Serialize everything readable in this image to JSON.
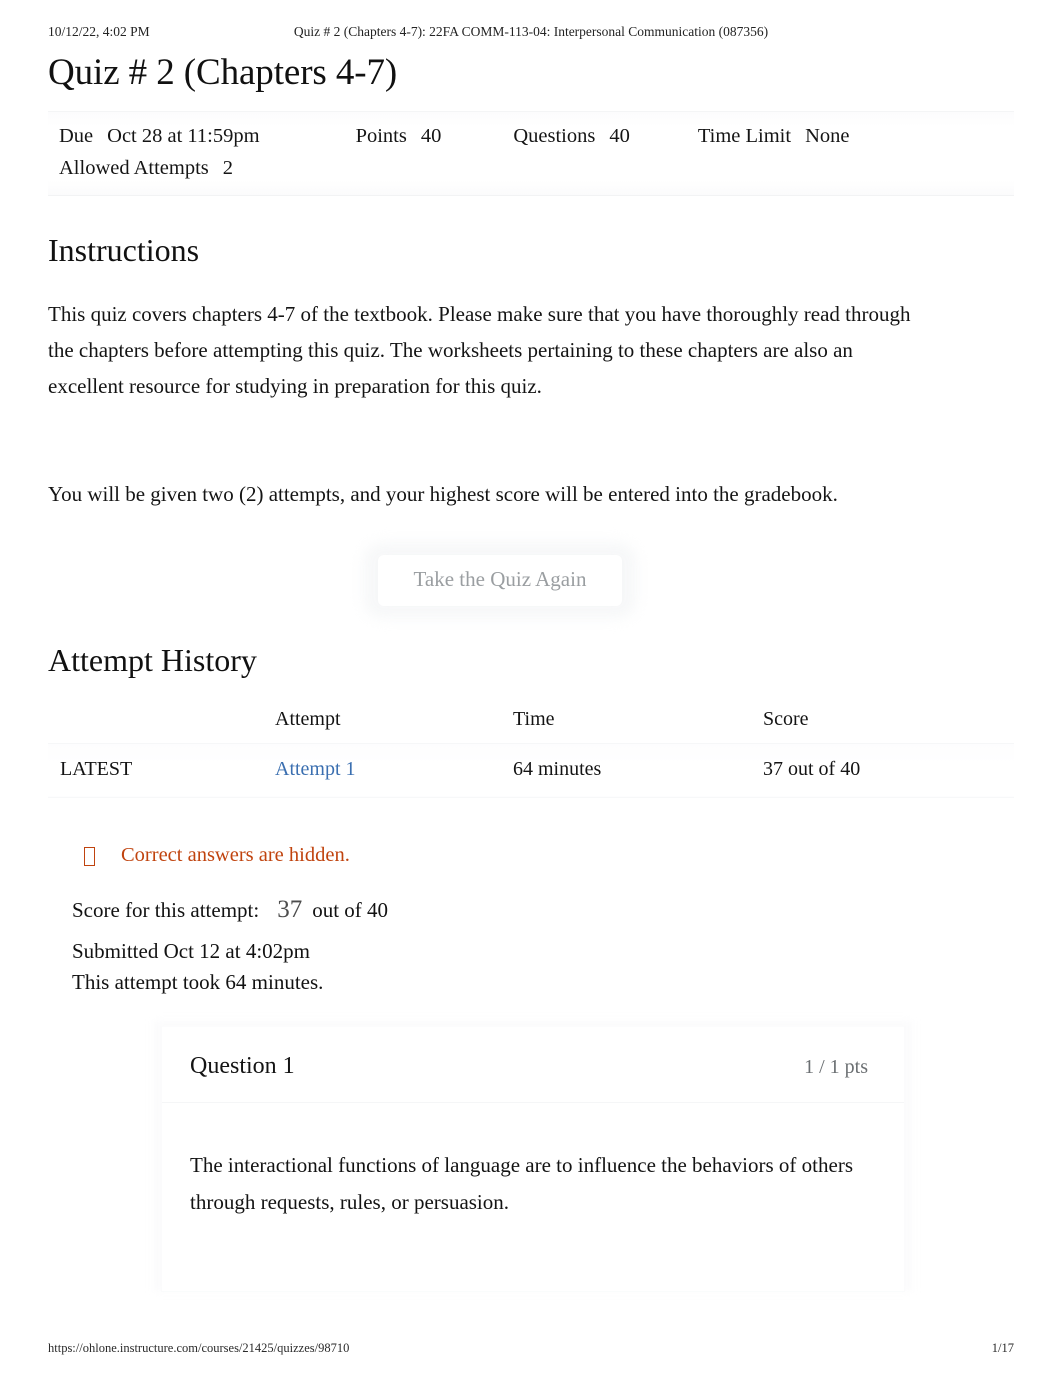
{
  "print_header": {
    "date": "10/12/22, 4:02 PM",
    "document_title": "Quiz # 2 (Chapters 4-7): 22FA COMM-113-04: Interpersonal Communication (087356)"
  },
  "print_footer": {
    "url": "https://ohlone.instructure.com/courses/21425/quizzes/98710",
    "page": "1/17"
  },
  "quiz": {
    "title": "Quiz # 2 (Chapters 4-7)",
    "meta": {
      "due_label": "Due",
      "due_value": "Oct 28 at 11:59pm",
      "points_label": "Points",
      "points_value": "40",
      "questions_label": "Questions",
      "questions_value": "40",
      "time_limit_label": "Time Limit",
      "time_limit_value": "None",
      "allowed_attempts_label": "Allowed Attempts",
      "allowed_attempts_value": "2"
    }
  },
  "instructions": {
    "heading": "Instructions",
    "paragraph_1": "This quiz covers chapters 4-7 of the textbook. Please make sure that you have thoroughly read through the chapters before attempting this quiz. The worksheets pertaining to these chapters are also an excellent resource for studying in preparation for this quiz.",
    "paragraph_2": "You will be given two (2) attempts, and your highest score will be entered into the gradebook."
  },
  "take_quiz_again_button": {
    "label": "Take the Quiz Again"
  },
  "attempt_history": {
    "heading": "Attempt History",
    "columns": {
      "latest": "",
      "attempt": "Attempt",
      "time": "Time",
      "score": "Score"
    },
    "rows": [
      {
        "latest_tag": "LATEST",
        "attempt": "Attempt 1",
        "time": "64 minutes",
        "score": "37 out of 40"
      }
    ]
  },
  "answers_hidden_notice": {
    "icon": "missing-glyph-box-icon",
    "text": "Correct answers are hidden.",
    "color": "#c0430e"
  },
  "attempt_summary": {
    "score_label": "Score for this attempt:",
    "score_value": "37",
    "score_suffix": "out of 40",
    "submitted": "Submitted Oct 12 at 4:02pm",
    "duration": "This attempt took 64 minutes."
  },
  "questions": [
    {
      "title": "Question 1",
      "points": "1 / 1 pts",
      "text": "The interactional functions of language are to influence the behaviors of others through requests, rules, or persuasion."
    }
  ],
  "colors": {
    "link_blue": "#3b6fb0",
    "notice_orange": "#c0430e",
    "muted_gray": "#6b6f72",
    "body_text": "#131313"
  }
}
